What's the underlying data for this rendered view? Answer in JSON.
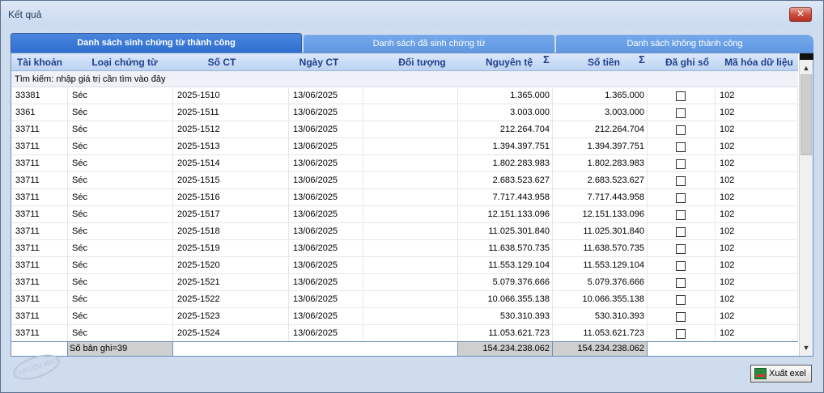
{
  "window": {
    "title": "Kết quả",
    "close_label": "✕"
  },
  "tabs": [
    {
      "label": "Danh sách sinh chứng từ thành công",
      "active": true
    },
    {
      "label": "Danh sách đã sinh chứng từ",
      "active": false
    },
    {
      "label": "Danh sách không thành công",
      "active": false
    }
  ],
  "columns": {
    "tai_khoan": "Tài khoản",
    "loai_chung_tu": "Loại chứng từ",
    "so_ct": "Số CT",
    "ngay_ct": "Ngày CT",
    "doi_tuong": "Đối tượng",
    "nguyen_te": "Nguyên tệ",
    "so_tien": "Số tiền",
    "da_ghi_so": "Đã ghi sổ",
    "ma_hoa": "Mã hóa dữ liệu",
    "sigma": "Σ"
  },
  "search": {
    "placeholder": "Tìm kiếm: nhập giá trị cần tìm vào đây"
  },
  "rows": [
    {
      "tk": "33381",
      "loai": "Séc",
      "so": "2025-1510",
      "ngay": "13/06/2025",
      "dt": "",
      "nt": "1.365.000",
      "st": "1.365.000",
      "ghi": false,
      "ma": "102"
    },
    {
      "tk": "3361",
      "loai": "Séc",
      "so": "2025-1511",
      "ngay": "13/06/2025",
      "dt": "",
      "nt": "3.003.000",
      "st": "3.003.000",
      "ghi": false,
      "ma": "102"
    },
    {
      "tk": "33711",
      "loai": "Séc",
      "so": "2025-1512",
      "ngay": "13/06/2025",
      "dt": "",
      "nt": "212.264.704",
      "st": "212.264.704",
      "ghi": false,
      "ma": "102"
    },
    {
      "tk": "33711",
      "loai": "Séc",
      "so": "2025-1513",
      "ngay": "13/06/2025",
      "dt": "",
      "nt": "1.394.397.751",
      "st": "1.394.397.751",
      "ghi": false,
      "ma": "102"
    },
    {
      "tk": "33711",
      "loai": "Séc",
      "so": "2025-1514",
      "ngay": "13/06/2025",
      "dt": "",
      "nt": "1.802.283.983",
      "st": "1.802.283.983",
      "ghi": false,
      "ma": "102"
    },
    {
      "tk": "33711",
      "loai": "Séc",
      "so": "2025-1515",
      "ngay": "13/06/2025",
      "dt": "",
      "nt": "2.683.523.627",
      "st": "2.683.523.627",
      "ghi": false,
      "ma": "102"
    },
    {
      "tk": "33711",
      "loai": "Séc",
      "so": "2025-1516",
      "ngay": "13/06/2025",
      "dt": "",
      "nt": "7.717.443.958",
      "st": "7.717.443.958",
      "ghi": false,
      "ma": "102"
    },
    {
      "tk": "33711",
      "loai": "Séc",
      "so": "2025-1517",
      "ngay": "13/06/2025",
      "dt": "",
      "nt": "12.151.133.096",
      "st": "12.151.133.096",
      "ghi": false,
      "ma": "102"
    },
    {
      "tk": "33711",
      "loai": "Séc",
      "so": "2025-1518",
      "ngay": "13/06/2025",
      "dt": "",
      "nt": "11.025.301.840",
      "st": "11.025.301.840",
      "ghi": false,
      "ma": "102"
    },
    {
      "tk": "33711",
      "loai": "Séc",
      "so": "2025-1519",
      "ngay": "13/06/2025",
      "dt": "",
      "nt": "11.638.570.735",
      "st": "11.638.570.735",
      "ghi": false,
      "ma": "102"
    },
    {
      "tk": "33711",
      "loai": "Séc",
      "so": "2025-1520",
      "ngay": "13/06/2025",
      "dt": "",
      "nt": "11.553.129.104",
      "st": "11.553.129.104",
      "ghi": false,
      "ma": "102"
    },
    {
      "tk": "33711",
      "loai": "Séc",
      "so": "2025-1521",
      "ngay": "13/06/2025",
      "dt": "",
      "nt": "5.079.376.666",
      "st": "5.079.376.666",
      "ghi": false,
      "ma": "102"
    },
    {
      "tk": "33711",
      "loai": "Séc",
      "so": "2025-1522",
      "ngay": "13/06/2025",
      "dt": "",
      "nt": "10.066.355.138",
      "st": "10.066.355.138",
      "ghi": false,
      "ma": "102"
    },
    {
      "tk": "33711",
      "loai": "Séc",
      "so": "2025-1523",
      "ngay": "13/06/2025",
      "dt": "",
      "nt": "530.310.393",
      "st": "530.310.393",
      "ghi": false,
      "ma": "102"
    },
    {
      "tk": "33711",
      "loai": "Séc",
      "so": "2025-1524",
      "ngay": "13/06/2025",
      "dt": "",
      "nt": "11.053.621.723",
      "st": "11.053.621.723",
      "ghi": false,
      "ma": "102"
    }
  ],
  "footer": {
    "record_count": "Số bản ghi=39",
    "total_nguyen_te": "154.234.238.062",
    "total_so_tien": "154.234.238.062"
  },
  "export_button": {
    "label": "Xuất exel"
  },
  "watermark": {
    "text": "GUI LIEU MAU"
  },
  "scrollbar": {
    "up": "▲",
    "down": "▼"
  }
}
